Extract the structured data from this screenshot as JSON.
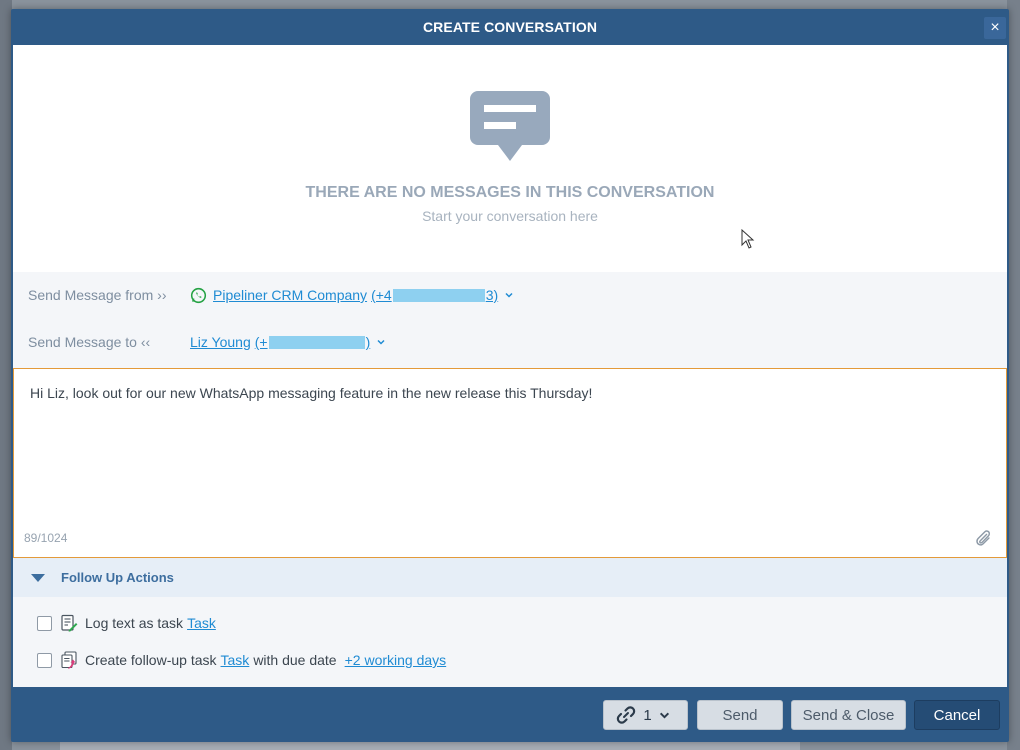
{
  "modal": {
    "title": "CREATE CONVERSATION",
    "close_label": "×"
  },
  "empty_state": {
    "title": "THERE ARE NO MESSAGES IN THIS CONVERSATION",
    "subtitle": "Start your conversation here"
  },
  "send_from": {
    "label": "Send Message from ››",
    "name": "Pipeliner CRM Company",
    "phone_prefix": "(+4",
    "phone_suffix": "3)"
  },
  "send_to": {
    "label": "Send Message to ‹‹",
    "name": "Liz Young",
    "phone_prefix": "(+",
    "phone_suffix": ")"
  },
  "composer": {
    "text": "Hi Liz, look out for our new WhatsApp messaging feature in the new release this Thursday!",
    "counter": "89/1024"
  },
  "follow_up": {
    "title": "Follow Up Actions",
    "log_text": "Log text as task",
    "log_link": "Task",
    "create_text": "Create follow-up task",
    "create_link": "Task",
    "with_due": "with due date",
    "due_link": "+2 working days"
  },
  "footer": {
    "link_count": "1",
    "send_label": "Send",
    "send_close_label": "Send & Close",
    "cancel_label": "Cancel"
  },
  "colors": {
    "header_bg": "#2e5a87",
    "accent_link": "#1f8bd3",
    "composer_border": "#e39a3a",
    "whatsapp_green": "#25a244"
  },
  "icons": {
    "chat": "chat-bubble-icon",
    "whatsapp": "whatsapp-icon",
    "attach": "paperclip-icon",
    "task_log": "task-log-icon",
    "task_followup": "task-followup-icon",
    "link": "link-icon"
  }
}
